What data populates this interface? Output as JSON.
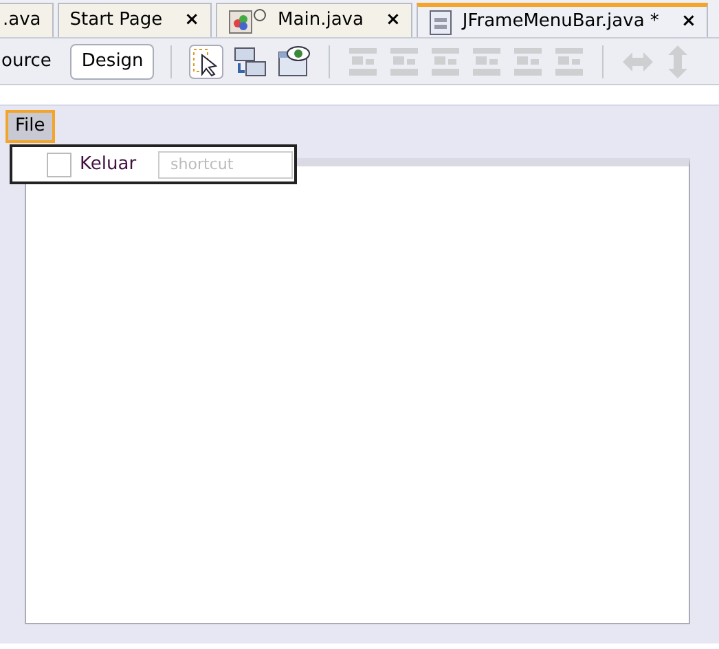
{
  "tabs": [
    {
      "kind": "plain",
      "label": ".ava",
      "selected": false
    },
    {
      "kind": "plain",
      "label": "Start Page",
      "close": "×",
      "selected": false
    },
    {
      "kind": "class",
      "label": "Main.java",
      "close": "×",
      "selected": false
    },
    {
      "kind": "form",
      "label": "JFrameMenuBar.java *",
      "close": "×",
      "selected": true
    }
  ],
  "view_buttons": [
    {
      "label": "ource",
      "selected": false
    },
    {
      "label": "Design",
      "selected": true
    }
  ],
  "toolbar": [
    {
      "kind": "select",
      "disabled": false
    },
    {
      "kind": "connect",
      "disabled": false
    },
    {
      "kind": "preview",
      "disabled": false
    },
    {
      "kind": "sep"
    },
    {
      "kind": "align",
      "disabled": true
    },
    {
      "kind": "align",
      "disabled": true
    },
    {
      "kind": "align",
      "disabled": true
    },
    {
      "kind": "align",
      "disabled": true
    },
    {
      "kind": "align",
      "disabled": true
    },
    {
      "kind": "align",
      "disabled": true
    },
    {
      "kind": "sep"
    },
    {
      "kind": "hresize",
      "disabled": true
    },
    {
      "kind": "vresize",
      "disabled": true
    }
  ],
  "menubar": [
    {
      "label": "File",
      "selected": true
    }
  ],
  "menu_items": [
    {
      "label": "Keluar",
      "checked": false,
      "placeholder": "shortcut"
    }
  ]
}
